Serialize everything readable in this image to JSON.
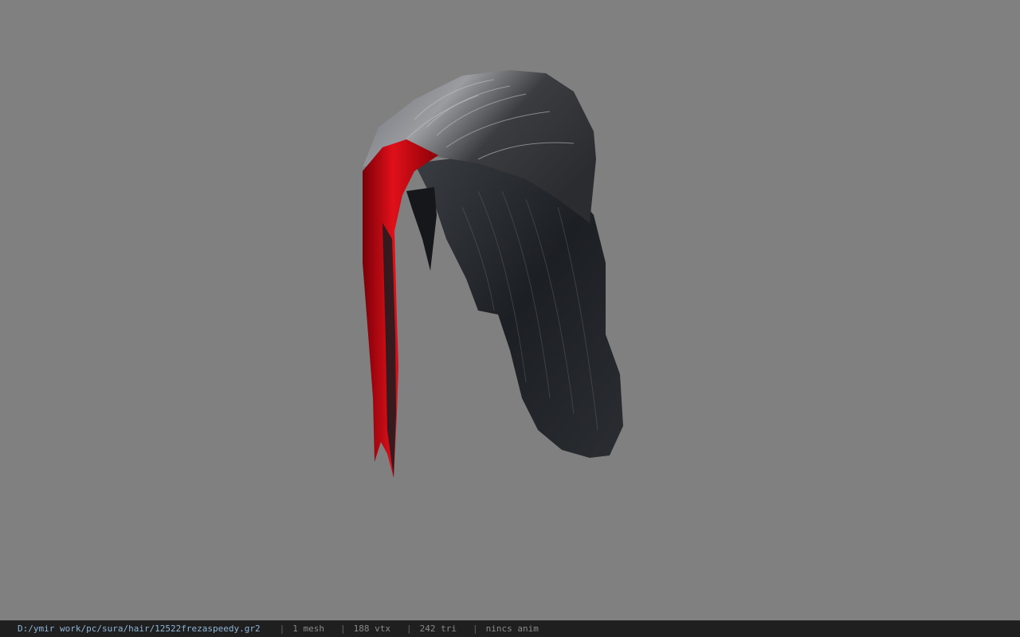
{
  "viewport": {
    "background": "#808080",
    "model_name": "hair mesh (black with red streak)"
  },
  "status_bar": {
    "file_path": "D:/ymir work/pc/sura/hair/12522frezaspeedy.gr2",
    "separator": "|",
    "mesh_count": "1 mesh",
    "vertex_count": "188 vtx",
    "triangle_count": "242 tri",
    "animation": "nincs anim",
    "path_color": "#8fb6d8",
    "text_color": "#8a8a8a"
  }
}
